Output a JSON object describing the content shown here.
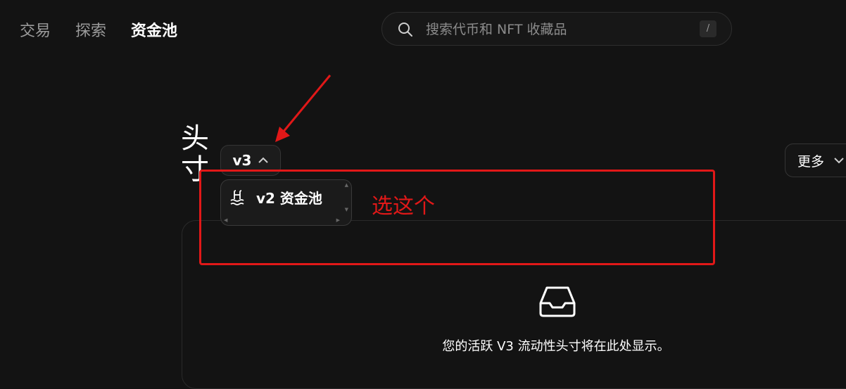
{
  "nav": {
    "items": [
      {
        "label": "交易",
        "active": false
      },
      {
        "label": "探索",
        "active": false
      },
      {
        "label": "资金池",
        "active": true
      }
    ]
  },
  "search": {
    "placeholder": "搜索代币和 NFT 收藏品",
    "shortcut": "/"
  },
  "page": {
    "title": "头寸"
  },
  "version_selector": {
    "label": "v3"
  },
  "more_button": {
    "label": "更多"
  },
  "dropdown": {
    "item_label": "v2 资金池"
  },
  "empty_state": {
    "text": "您的活跃 V3 流动性头寸将在此处显示。"
  },
  "annotation": {
    "label": "选这个",
    "color": "#e11818"
  }
}
